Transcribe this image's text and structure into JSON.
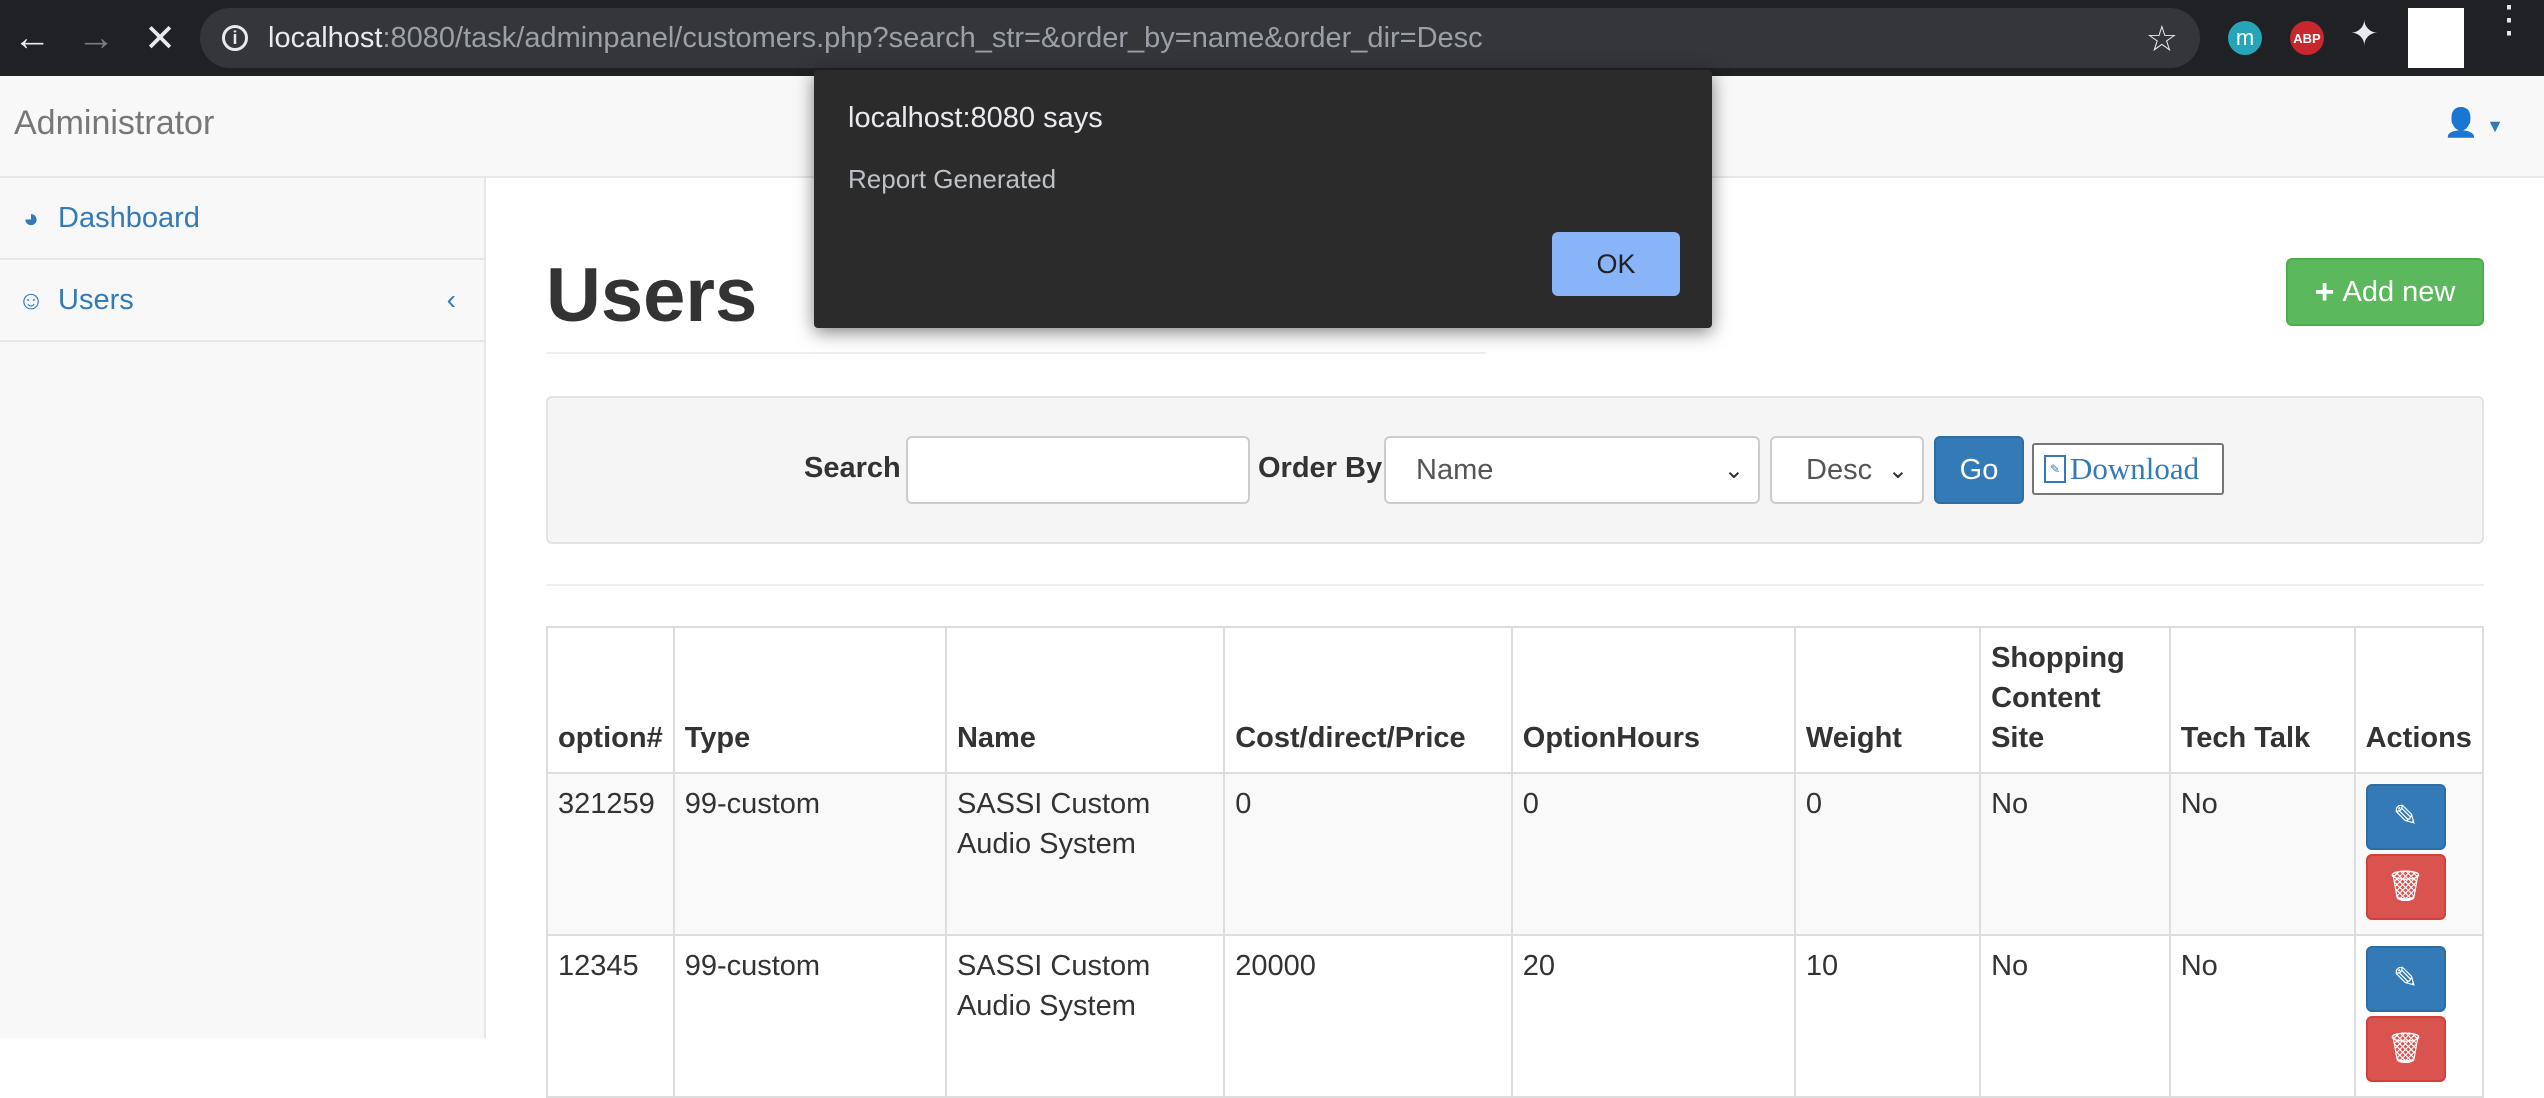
{
  "browser": {
    "url_host": "localhost",
    "url_rest": ":8080/task/adminpanel/customers.php?search_str=&order_by=name&order_dir=Desc",
    "ext_m_label": "m",
    "ext_abp_label": "ABP"
  },
  "navbar": {
    "brand": "Administrator"
  },
  "sidebar": {
    "items": [
      {
        "label": "Dashboard"
      },
      {
        "label": "Users"
      }
    ]
  },
  "main": {
    "title": "Users",
    "add_button": "Add new"
  },
  "filters": {
    "search_label": "Search",
    "search_value": "",
    "order_by_label": "Order By",
    "order_by_value": "Name",
    "order_dir_value": "Desc",
    "go_button": "Go",
    "download_button": "Download"
  },
  "table": {
    "headers": [
      "option#",
      "Type",
      "Name",
      "Cost/direct/Price",
      "OptionHours",
      "Weight",
      "Shopping Content Site",
      "Tech Talk",
      "Actions"
    ],
    "rows": [
      [
        "321259",
        "99-custom",
        "SASSI Custom Audio System",
        "0",
        "0",
        "0",
        "No",
        "No"
      ],
      [
        "12345",
        "99-custom",
        "SASSI Custom Audio System",
        "20000",
        "20",
        "10",
        "No",
        "No"
      ]
    ]
  },
  "dialog": {
    "title": "localhost:8080 says",
    "message": "Report Generated",
    "ok_button": "OK"
  },
  "colors": {
    "chrome_bg": "#202124",
    "link_blue": "#337ab7",
    "success_green": "#5cb85c",
    "danger_red": "#d9534f",
    "dialog_bg": "#2b2b2c",
    "dialog_button": "#8ab4f8"
  }
}
